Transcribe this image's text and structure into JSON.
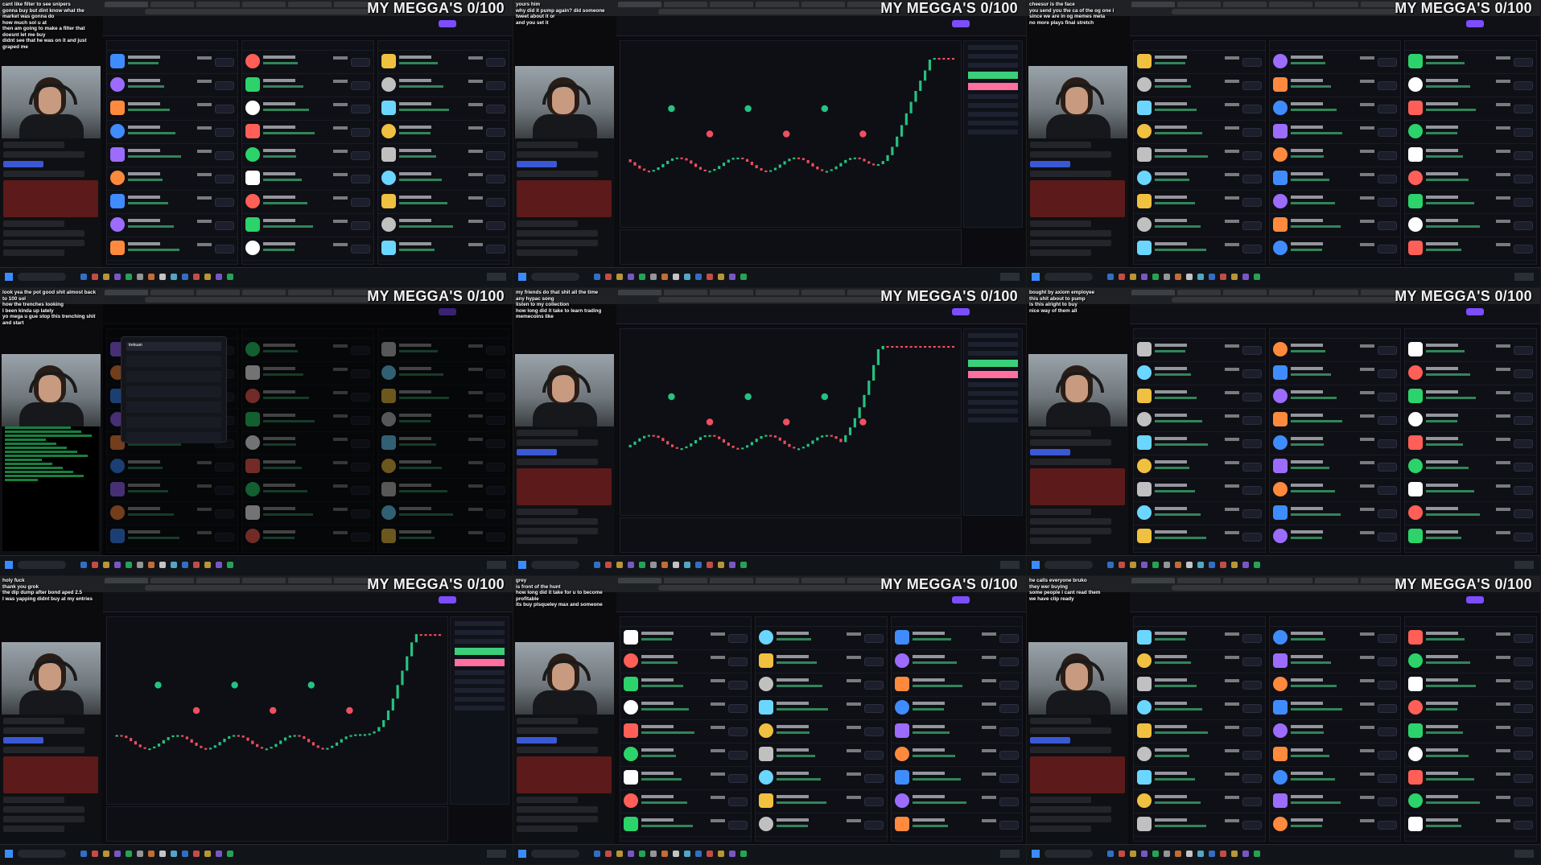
{
  "overlay_title": "MY MEGGA'S 0/100",
  "tiles": [
    {
      "type": "pulse",
      "chat": [
        {
          "user": "",
          "text": "cant like filter to see snipers"
        },
        {
          "user": "",
          "text": "gonna buy but dint know what the market was gonna do"
        },
        {
          "user": "",
          "text": "how much sol u at"
        },
        {
          "user": "",
          "text": "then am going to make a filter that doesnt let me buy"
        },
        {
          "user": "",
          "text": "didnt see that he was on it and just graped me"
        }
      ]
    },
    {
      "type": "chart",
      "chat": [
        {
          "user": "",
          "text": "yours him"
        },
        {
          "user": "",
          "text": "why did it pump again? did someone tweet about it or"
        },
        {
          "user": "",
          "text": "and you set it"
        }
      ]
    },
    {
      "type": "pulse",
      "chat": [
        {
          "user": "",
          "text": "cheesur is the face"
        },
        {
          "user": "",
          "text": "you send you the ca of the og one i"
        },
        {
          "user": "",
          "text": "since we are in og memes meta"
        },
        {
          "user": "",
          "text": "no more plays final stretch"
        }
      ]
    },
    {
      "type": "search",
      "chat": [
        {
          "user": "",
          "text": "look yea the pot good shit almost back to 100 sol"
        },
        {
          "user": "",
          "text": "how the trenches looking"
        },
        {
          "user": "",
          "text": "I been kinda up lately"
        },
        {
          "user": "",
          "text": "yo mega u gue stop this trenching shit and start"
        }
      ],
      "search_text": "trekuan"
    },
    {
      "type": "chart",
      "chat": [
        {
          "user": "",
          "text": "my friends do that shit all the time"
        },
        {
          "user": "",
          "text": "any hypac song"
        },
        {
          "user": "",
          "text": "listen to my collection"
        },
        {
          "user": "",
          "text": "how long did it take to learn trading memecoins like"
        }
      ]
    },
    {
      "type": "pulse",
      "chat": [
        {
          "user": "",
          "text": "bought by axiom employee"
        },
        {
          "user": "",
          "text": "this shit about to pump"
        },
        {
          "user": "",
          "text": "is this alright to buy"
        },
        {
          "user": "",
          "text": "nice way of them all"
        }
      ]
    },
    {
      "type": "chart",
      "chat": [
        {
          "user": "",
          "text": "holy fuck"
        },
        {
          "user": "",
          "text": "thank you grok"
        },
        {
          "user": "",
          "text": "the dip dump after bond aped 2.5"
        },
        {
          "user": "",
          "text": "I was yapping didnt buy at my entries"
        }
      ]
    },
    {
      "type": "pulse",
      "chat": [
        {
          "user": "",
          "text": "grey"
        },
        {
          "user": "",
          "text": "is front of the hunt"
        },
        {
          "user": "",
          "text": "how long did it take for u to become profitable"
        },
        {
          "user": "",
          "text": "its buy plsqueley max and someone"
        }
      ]
    },
    {
      "type": "pulse",
      "chat": [
        {
          "user": "",
          "text": "he calls everyone bruko"
        },
        {
          "user": "",
          "text": "they wer buying"
        },
        {
          "user": "",
          "text": "some people i cant read them"
        },
        {
          "user": "",
          "text": "we have clip ready"
        }
      ]
    }
  ]
}
